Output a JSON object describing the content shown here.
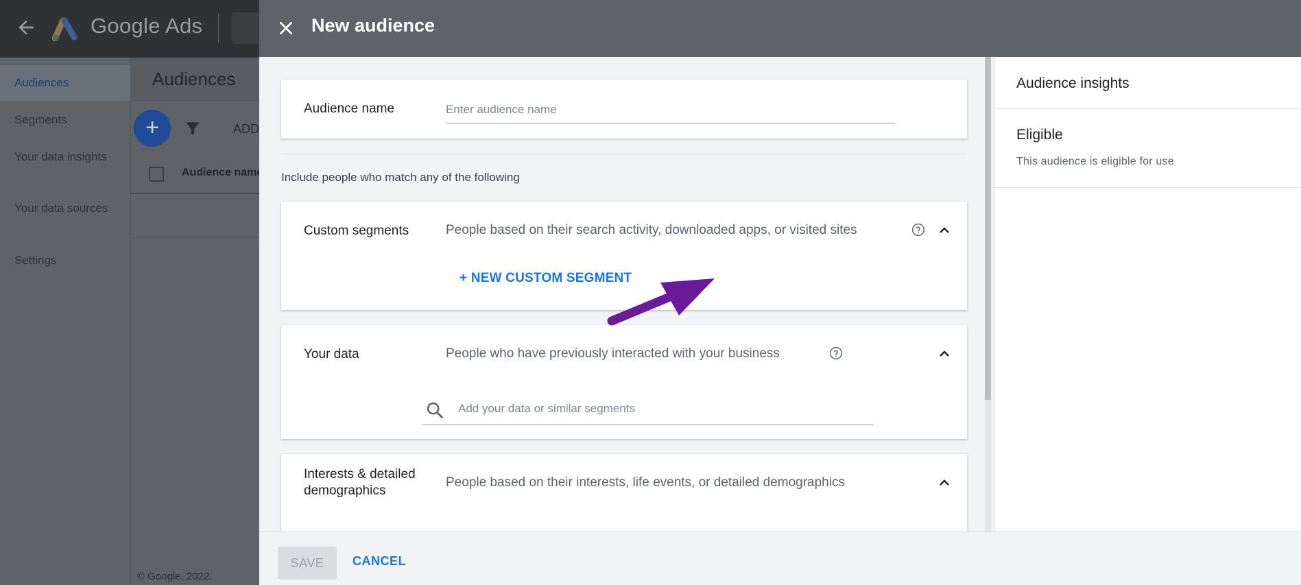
{
  "background": {
    "brand": "Google Ads",
    "sidebar": [
      {
        "label": "Audiences",
        "active": true
      },
      {
        "label": "Segments"
      },
      {
        "label": "Your data insights"
      },
      {
        "label": "Your data sources"
      },
      {
        "label": "Settings"
      }
    ],
    "page_title": "Audiences",
    "add_label": "ADD",
    "column_header": "Audience name",
    "footer": "© Google, 2022."
  },
  "dialog": {
    "title": "New audience",
    "audience_name": {
      "label": "Audience name",
      "placeholder": "Enter audience name",
      "value": ""
    },
    "include_text": "Include people who match any of the following",
    "custom_segments": {
      "label": "Custom segments",
      "description": "People based on their search activity, downloaded apps, or visited sites",
      "new_button": "+ NEW CUSTOM SEGMENT"
    },
    "your_data": {
      "label": "Your data",
      "description": "People who have previously interacted with your business",
      "search_placeholder": "Add your data or similar segments"
    },
    "interests": {
      "label": "Interests & detailed demographics",
      "description": "People based on their interests, life events, or detailed demographics"
    },
    "save_label": "SAVE",
    "cancel_label": "CANCEL"
  },
  "insights": {
    "title": "Audience insights",
    "status": "Eligible",
    "status_desc": "This audience is eligible for use"
  },
  "colors": {
    "accent": "#1a73e8",
    "header": "#5f6368",
    "annotation_arrow": "#6a1b9a"
  }
}
